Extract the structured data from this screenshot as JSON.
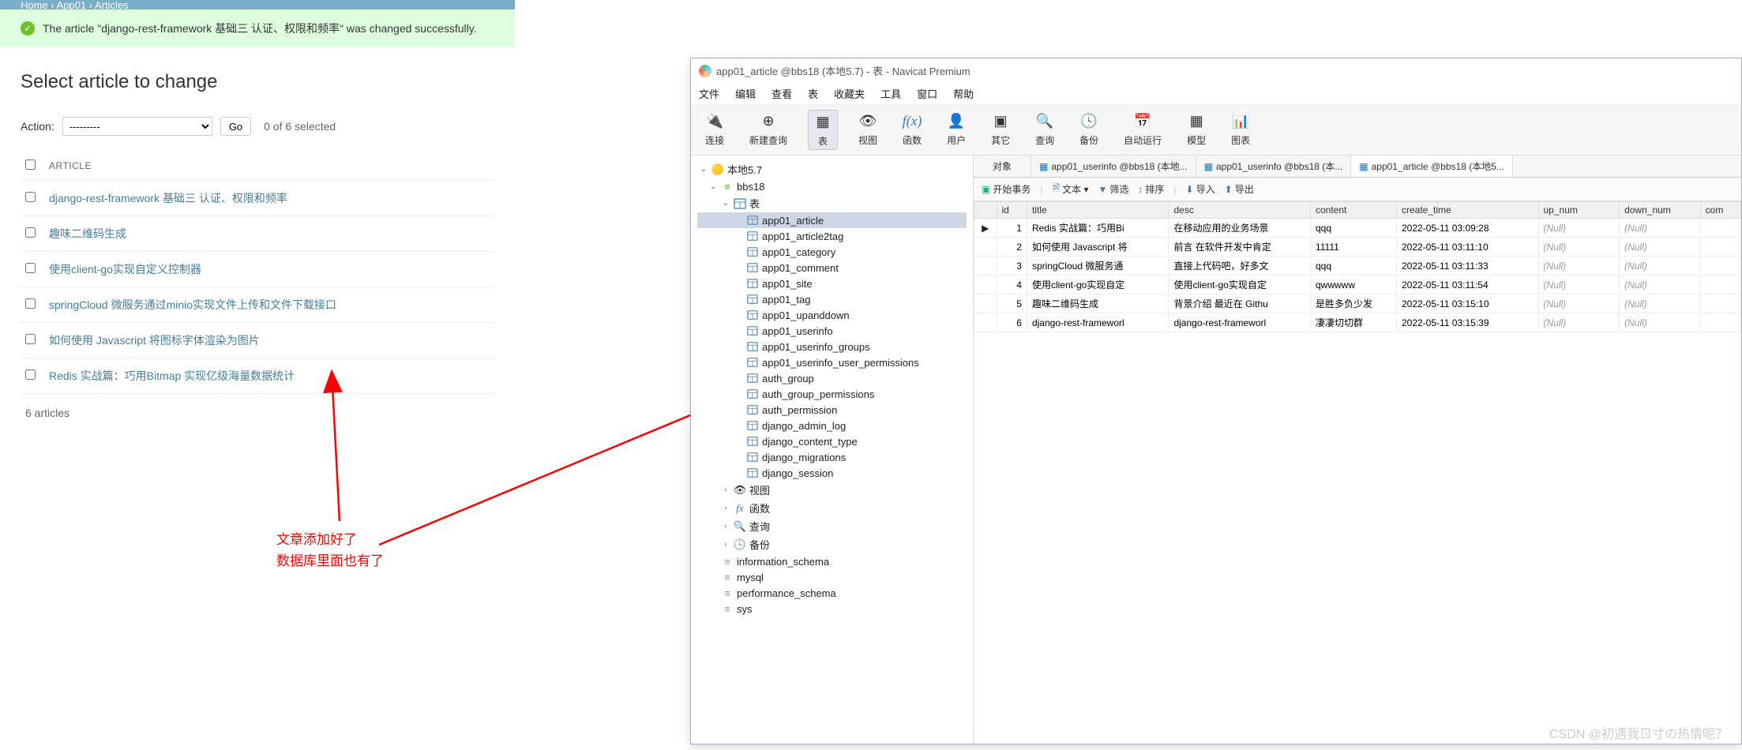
{
  "django": {
    "breadcrumb": "Home › App01 › Articles",
    "success_prefix": "The article \"",
    "success_title": "django-rest-framework 基础三 认证、权限和频率",
    "success_suffix": "\" was changed successfully.",
    "page_title": "Select article to change",
    "action_label": "Action:",
    "action_placeholder": "---------",
    "go_label": "Go",
    "selected": "0 of 6 selected",
    "col_header": "ARTICLE",
    "rows": [
      "django-rest-framework 基础三 认证、权限和频率",
      "趣味二维码生成",
      "使用client-go实现自定义控制器",
      "springCloud 微服务通过minio实现文件上传和文件下载接口",
      "如何使用 Javascript 将图标字体渲染为图片",
      "Redis 实战篇：巧用Bitmap 实现亿级海量数据统计"
    ],
    "footer": "6 articles"
  },
  "annotation": {
    "line1": "文章添加好了",
    "line2": "数据库里面也有了"
  },
  "navicat": {
    "window_title": "app01_article @bbs18 (本地5.7) - 表 - Navicat Premium",
    "menus": [
      "文件",
      "编辑",
      "查看",
      "表",
      "收藏夹",
      "工具",
      "窗口",
      "帮助"
    ],
    "toolbar": [
      {
        "label": "连接",
        "icon": "🔌"
      },
      {
        "label": "新建查询",
        "icon": "⊕"
      },
      {
        "label": "表",
        "icon": "▦",
        "active": true
      },
      {
        "label": "视图",
        "icon": "👁"
      },
      {
        "label": "函数",
        "icon": "f(x)"
      },
      {
        "label": "用户",
        "icon": "👤"
      },
      {
        "label": "其它",
        "icon": "▣"
      },
      {
        "label": "查询",
        "icon": "🔍"
      },
      {
        "label": "备份",
        "icon": "🕓"
      },
      {
        "label": "自动运行",
        "icon": "📅"
      },
      {
        "label": "模型",
        "icon": "▦"
      },
      {
        "label": "图表",
        "icon": "📊"
      }
    ],
    "tree": {
      "conn": "本地5.7",
      "db": "bbs18",
      "tables_label": "表",
      "tables": [
        "app01_article",
        "app01_article2tag",
        "app01_category",
        "app01_comment",
        "app01_site",
        "app01_tag",
        "app01_upanddown",
        "app01_userinfo",
        "app01_userinfo_groups",
        "app01_userinfo_user_permissions",
        "auth_group",
        "auth_group_permissions",
        "auth_permission",
        "django_admin_log",
        "django_content_type",
        "django_migrations",
        "django_session"
      ],
      "views": "视图",
      "functions": "函数",
      "queries": "查询",
      "backups": "备份",
      "other_dbs": [
        "information_schema",
        "mysql",
        "performance_schema",
        "sys"
      ]
    },
    "tabs": {
      "obj": "对象",
      "t1": "app01_userinfo @bbs18 (本地...",
      "t2": "app01_userinfo @bbs18 (本...",
      "t3": "app01_article @bbs18 (本地5..."
    },
    "actionbar": {
      "begin": "开始事务",
      "text": "文本 ▾",
      "filter": "筛选",
      "sort": "排序",
      "import": "导入",
      "export": "导出"
    },
    "grid": {
      "cols": [
        "id",
        "title",
        "desc",
        "content",
        "create_time",
        "up_num",
        "down_num",
        "com"
      ],
      "rows": [
        {
          "ptr": "▶",
          "id": "1",
          "title": "Redis 实战篇：巧用Bi",
          "desc": "在移动应用的业务场景",
          "content": "qqq",
          "create_time": "2022-05-11 03:09:28",
          "up_num": "(Null)",
          "down_num": "(Null)"
        },
        {
          "ptr": "",
          "id": "2",
          "title": "如何使用 Javascript 将",
          "desc": "前言 在软件开发中肯定",
          "content": "11111",
          "create_time": "2022-05-11 03:11:10",
          "up_num": "(Null)",
          "down_num": "(Null)"
        },
        {
          "ptr": "",
          "id": "3",
          "title": "springCloud 微服务通",
          "desc": "直接上代码吧，好多文",
          "content": "qqq",
          "create_time": "2022-05-11 03:11:33",
          "up_num": "(Null)",
          "down_num": "(Null)"
        },
        {
          "ptr": "",
          "id": "4",
          "title": "使用client-go实现自定",
          "desc": "使用client-go实现自定",
          "content": "qwwwww",
          "create_time": "2022-05-11 03:11:54",
          "up_num": "(Null)",
          "down_num": "(Null)"
        },
        {
          "ptr": "",
          "id": "5",
          "title": "趣味二维码生成",
          "desc": "背景介绍 最近在 Githu",
          "content": "是胜多负少发",
          "create_time": "2022-05-11 03:15:10",
          "up_num": "(Null)",
          "down_num": "(Null)"
        },
        {
          "ptr": "",
          "id": "6",
          "title": "django-rest-frameworl",
          "desc": "django-rest-frameworl",
          "content": "凄凄切切群",
          "create_time": "2022-05-11 03:15:39",
          "up_num": "(Null)",
          "down_num": "(Null)"
        }
      ]
    }
  },
  "watermark": "CSDN @初遇我ㄖ寸の热情呢？"
}
